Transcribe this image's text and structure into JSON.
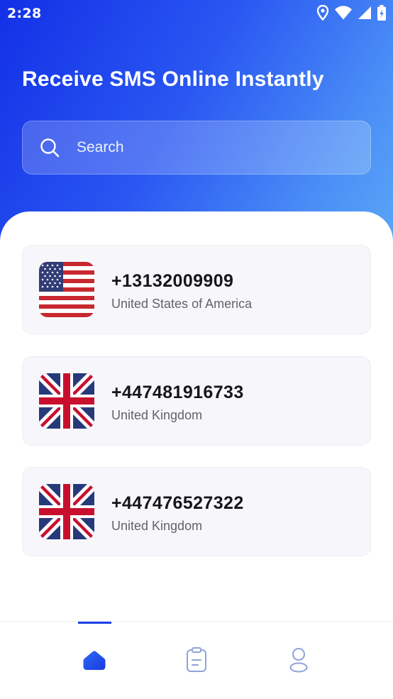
{
  "status_bar": {
    "time": "2:28",
    "icons": [
      "location-icon",
      "wifi-icon",
      "signal-icon",
      "battery-icon"
    ]
  },
  "header": {
    "title": "Receive SMS Online Instantly"
  },
  "search": {
    "placeholder": "Search",
    "icon": "search-icon"
  },
  "numbers": [
    {
      "phone": "+13132009909",
      "country": "United States of America",
      "flag": "us-flag-icon"
    },
    {
      "phone": "+447481916733",
      "country": "United Kingdom",
      "flag": "uk-flag-icon"
    },
    {
      "phone": "+447476527322",
      "country": "United Kingdom",
      "flag": "uk-flag-icon"
    }
  ],
  "bottom_nav": {
    "items": [
      {
        "icon": "home-icon",
        "active": true
      },
      {
        "icon": "clipboard-icon",
        "active": false
      },
      {
        "icon": "profile-icon",
        "active": false
      }
    ]
  },
  "colors": {
    "accent": "#1f3fe6",
    "header_gradient_start": "#1230e6",
    "header_gradient_end": "#5aa7f5",
    "card_background": "#f7f7fb"
  }
}
